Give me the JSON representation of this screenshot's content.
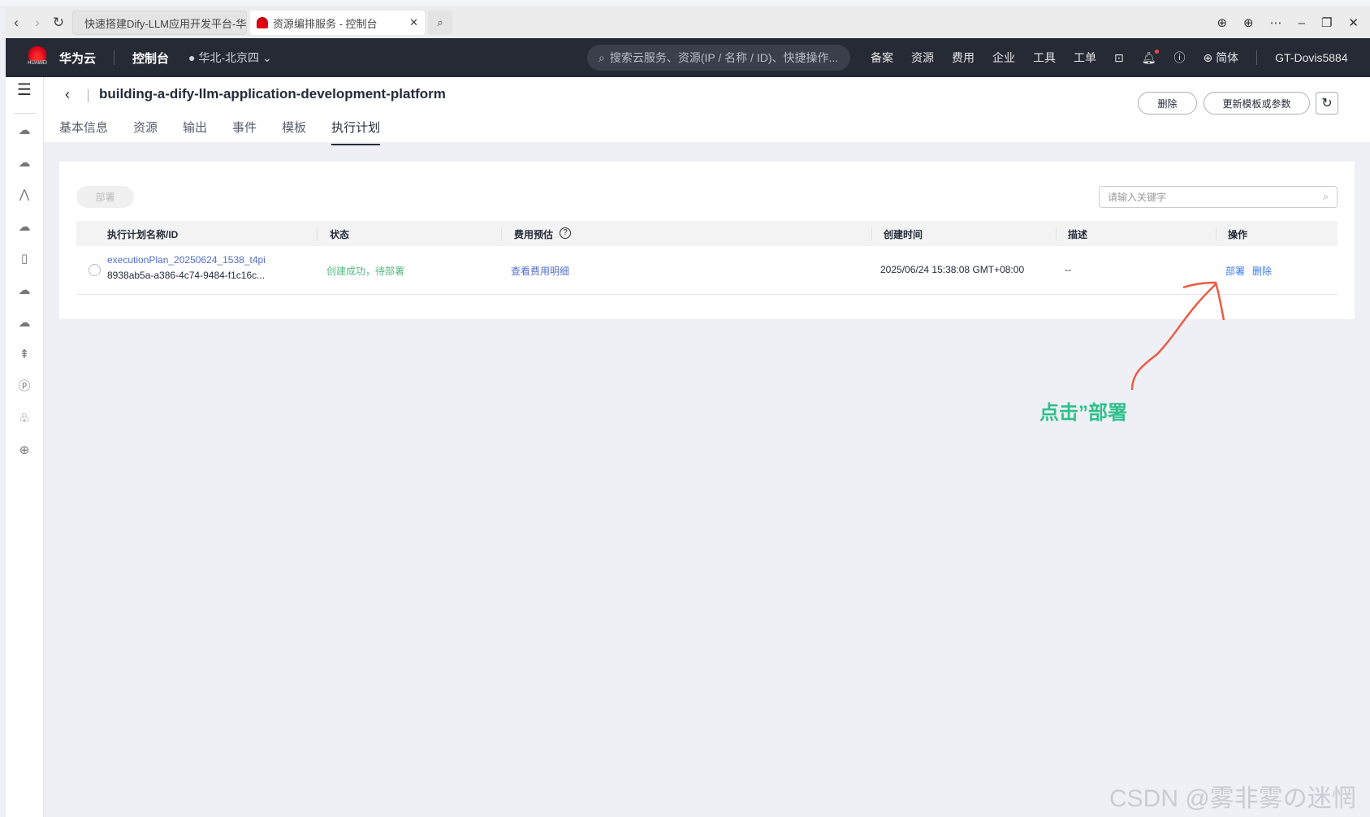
{
  "browser": {
    "tabs": [
      {
        "title": "快速搭建Dify-LLM应用开发平台-华"
      },
      {
        "title": "资源编排服务 - 控制台"
      }
    ]
  },
  "nav": {
    "brand": "华为云",
    "console": "控制台",
    "region": "华北-北京四",
    "search_placeholder": "搜索云服务、资源(IP / 名称 / ID)、快捷操作...",
    "links": [
      "备案",
      "资源",
      "费用",
      "企业",
      "工具",
      "工单"
    ],
    "language": "简体",
    "user": "GT-Dovis5884"
  },
  "page": {
    "title": "building-a-dify-llm-application-development-platform",
    "tabs": [
      "基本信息",
      "资源",
      "输出",
      "事件",
      "模板",
      "执行计划"
    ],
    "delete_label": "删除",
    "update_label": "更新模板或参数"
  },
  "toolbar": {
    "deploy_label": "部署",
    "search_placeholder": "请输入关键字"
  },
  "table": {
    "columns": [
      "执行计划名称/ID",
      "状态",
      "费用预估",
      "创建时间",
      "描述",
      "操作"
    ],
    "rows": [
      {
        "name": "executionPlan_20250624_1538_t4pi",
        "id": "8938ab5a-a386-4c74-9484-f1c16c...",
        "status": "创建成功，待部署",
        "cost": "查看费用明细",
        "created": "2025/06/24 15:38:08 GMT+08:00",
        "desc": "--",
        "actions": [
          "部署",
          "删除"
        ]
      }
    ]
  },
  "annotation": {
    "text": "点击”部署"
  },
  "watermark": "CSDN @雾非雾の迷惘",
  "colors": {
    "link": "#526ecc",
    "success": "#50b97e",
    "annotation": "#2ec08b",
    "arrow": "#ee5a45"
  }
}
